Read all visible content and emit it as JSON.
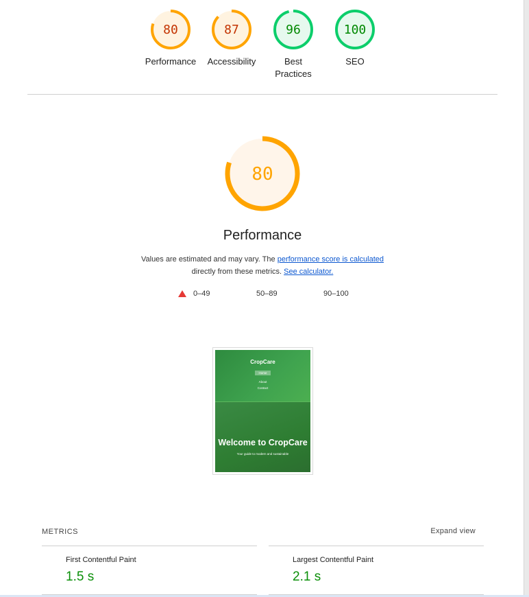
{
  "gauges": [
    {
      "score": "80",
      "label": "Performance",
      "value": 0.8,
      "color": "#ffa400",
      "text_color": "#c33300",
      "fill": "#fff3e0"
    },
    {
      "score": "87",
      "label": "Accessibility",
      "value": 0.87,
      "color": "#ffa400",
      "text_color": "#c33300",
      "fill": "#fff3e0"
    },
    {
      "score": "96",
      "label": "Best Practices",
      "value": 0.96,
      "color": "#0cce6b",
      "text_color": "#008800",
      "fill": "#e6f9ee"
    },
    {
      "score": "100",
      "label": "SEO",
      "value": 1.0,
      "color": "#0cce6b",
      "text_color": "#008800",
      "fill": "#e6f9ee"
    }
  ],
  "performance": {
    "score": "80",
    "value": 0.8,
    "title": "Performance",
    "desc_prefix": "Values are estimated and may vary. The ",
    "link1": "performance score is calculated",
    "desc_middle": " directly from these metrics. ",
    "link2": "See calculator."
  },
  "legend": {
    "fail": "0–49",
    "average": "50–89",
    "pass": "90–100"
  },
  "thumbnail": {
    "brand": "CropCare",
    "nav": [
      "Home",
      "About",
      "Contact"
    ],
    "hero_title": "Welcome to CropCare",
    "hero_sub": "Your guide to modern and sustainable"
  },
  "metrics": {
    "heading": "METRICS",
    "expand_label": "Expand view",
    "items": [
      {
        "name": "First Contentful Paint",
        "value": "1.5 s"
      },
      {
        "name": "Largest Contentful Paint",
        "value": "2.1 s"
      }
    ]
  },
  "colors": {
    "orange": "#ffa400",
    "green": "#0cce6b",
    "red": "#e53935",
    "link": "#0b57d0"
  }
}
